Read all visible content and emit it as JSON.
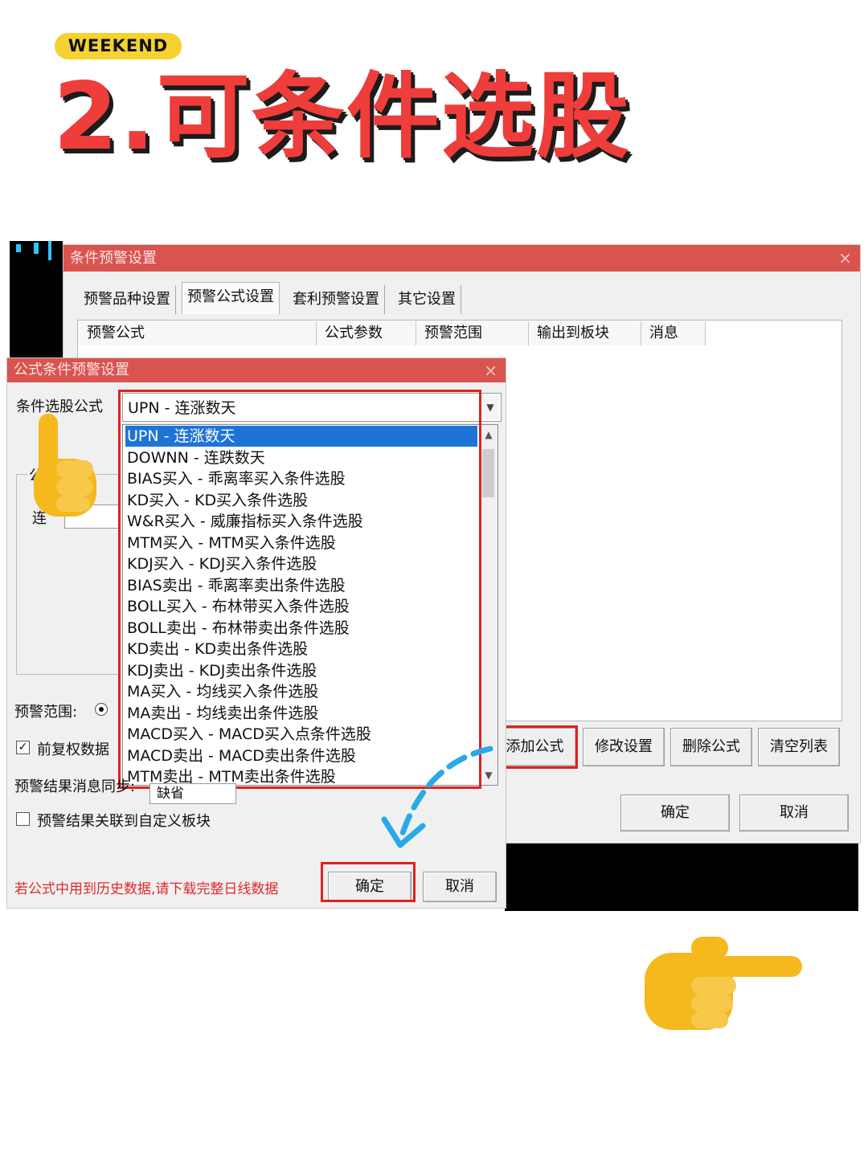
{
  "header": {
    "badge": "WEEKEND",
    "title": "2.可条件选股"
  },
  "back_window": {
    "title": "条件预警设置",
    "close": "×",
    "tabs": [
      "预警品种设置",
      "预警公式设置",
      "套利预警设置",
      "其它设置"
    ],
    "columns": [
      "预警公式",
      "公式参数",
      "预警范围",
      "输出到板块",
      "消息"
    ],
    "action_buttons": [
      "添加公式",
      "修改设置",
      "删除公式",
      "清空列表"
    ],
    "ok": "确定",
    "cancel": "取消"
  },
  "dialog": {
    "title": "公式条件预警设置",
    "close": "×",
    "formula_label": "条件选股公式",
    "selected_formula": "UPN  -  连涨数天",
    "group_label_partial": "公",
    "param_label_partial": "连",
    "range_label": "预警范围:",
    "adjust_label": "前复权数据",
    "sync_label": "预警结果消息同步:",
    "sync_value": "缺省",
    "link_label": "预警结果关联到自定义板块",
    "warning": "若公式中用到历史数据,请下载完整日线数据",
    "ok": "确定",
    "cancel": "取消",
    "formula_options": [
      "UPN  -  连涨数天",
      "DOWNN  -  连跌数天",
      "BIAS买入  -  乖离率买入条件选股",
      "KD买入  -  KD买入条件选股",
      "W&R买入  -  威廉指标买入条件选股",
      "MTM买入  -  MTM买入条件选股",
      "KDJ买入  -  KDJ买入条件选股",
      "BIAS卖出  -  乖离率卖出条件选股",
      "BOLL买入  -  布林带买入条件选股",
      "BOLL卖出  -  布林带卖出条件选股",
      "KD卖出  -  KD卖出条件选股",
      "KDJ卖出  -  KDJ卖出条件选股",
      "MA买入  -  均线买入条件选股",
      "MA卖出  -  均线卖出条件选股",
      "MACD买入  -  MACD买入点条件选股",
      "MACD卖出  -  MACD卖出条件选股",
      "MTM卖出  -  MTM卖出条件选股"
    ]
  },
  "icons": {
    "hand_down": "pointing-hand-icon",
    "hand_right": "pointing-right-hand-icon",
    "arrow": "curved-dashed-arrow-icon"
  },
  "colors": {
    "title_red": "#ee3d3a",
    "titlebar_red": "#d9534f",
    "badge_yellow": "#f4d232",
    "highlight_red": "#e02121",
    "selection_blue": "#1e74d6",
    "arrow_blue": "#2aa8e8"
  }
}
